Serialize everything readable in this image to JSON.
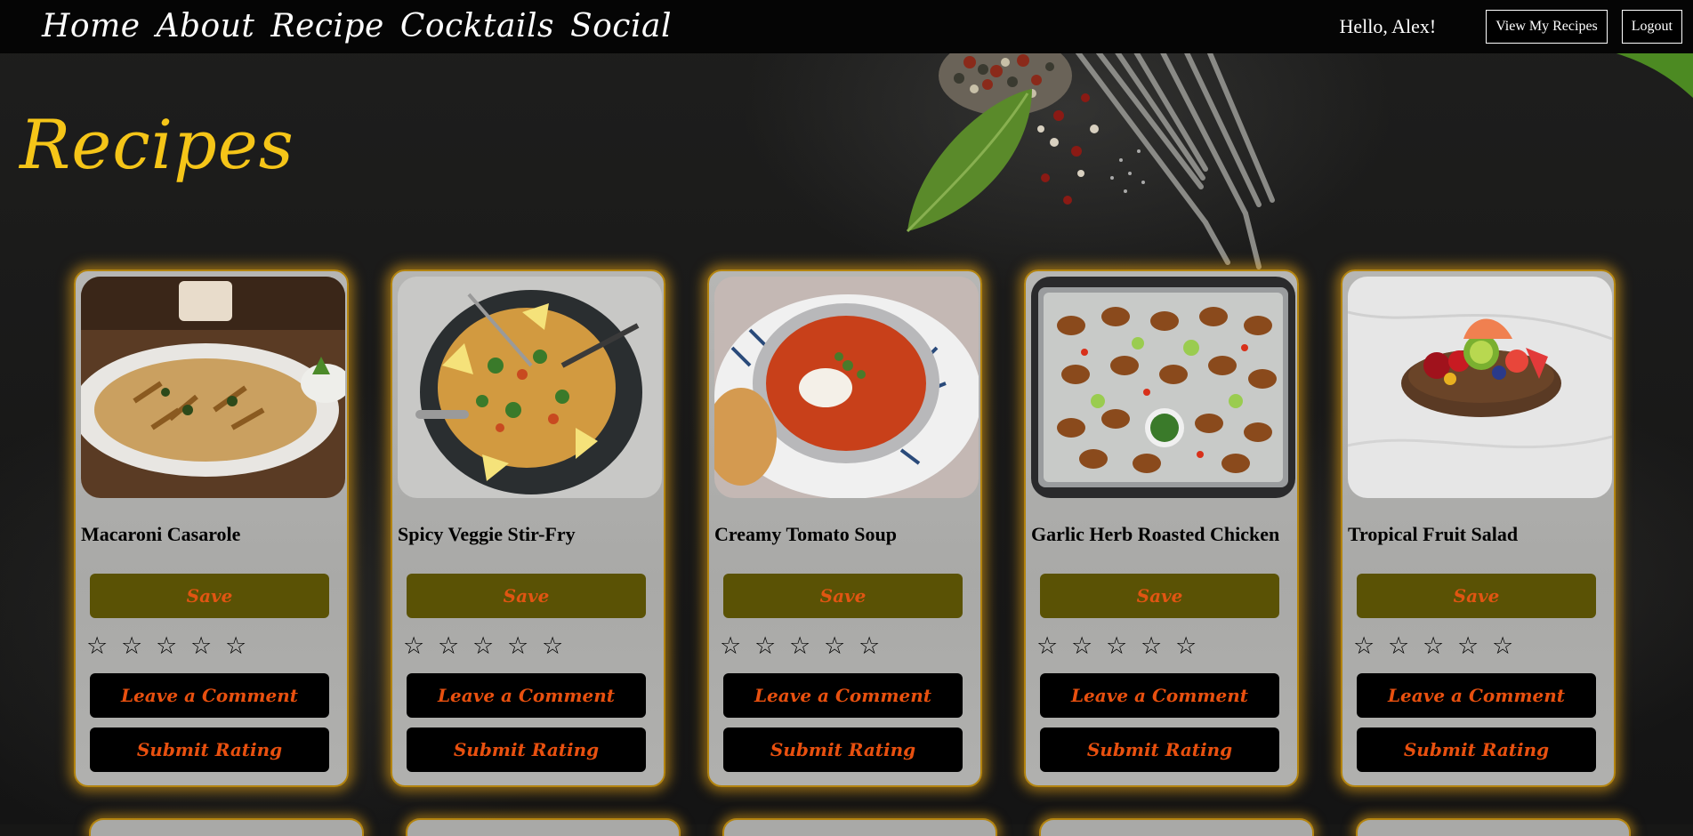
{
  "nav": {
    "links": [
      "Home",
      "About",
      "Recipe",
      "Cocktails",
      "Social"
    ],
    "greeting": "Hello, Alex!",
    "view_recipes_label": "View My Recipes",
    "logout_label": "Logout"
  },
  "page": {
    "title": "Recipes"
  },
  "recipes": [
    {
      "name": "Macaroni Casarole",
      "save_label": "Save",
      "comment_label": "Leave a Comment",
      "rating_label": "Submit Rating",
      "stars": [
        "☆",
        "☆",
        "☆",
        "☆",
        "☆"
      ]
    },
    {
      "name": "Spicy Veggie Stir-Fry",
      "save_label": "Save",
      "comment_label": "Leave a Comment",
      "rating_label": "Submit Rating",
      "stars": [
        "☆",
        "☆",
        "☆",
        "☆",
        "☆"
      ]
    },
    {
      "name": "Creamy Tomato Soup",
      "save_label": "Save",
      "comment_label": "Leave a Comment",
      "rating_label": "Submit Rating",
      "stars": [
        "☆",
        "☆",
        "☆",
        "☆",
        "☆"
      ]
    },
    {
      "name": "Garlic Herb Roasted Chicken",
      "save_label": "Save",
      "comment_label": "Leave a Comment",
      "rating_label": "Submit Rating",
      "stars": [
        "☆",
        "☆",
        "☆",
        "☆",
        "☆"
      ]
    },
    {
      "name": "Tropical Fruit Salad",
      "save_label": "Save",
      "comment_label": "Leave a Comment",
      "rating_label": "Submit Rating",
      "stars": [
        "☆",
        "☆",
        "☆",
        "☆",
        "☆"
      ]
    }
  ],
  "colors": {
    "title": "#f5c518",
    "card_glow": "#f0aa14",
    "save_bg": "#5a5205",
    "button_text": "#e8500f"
  }
}
